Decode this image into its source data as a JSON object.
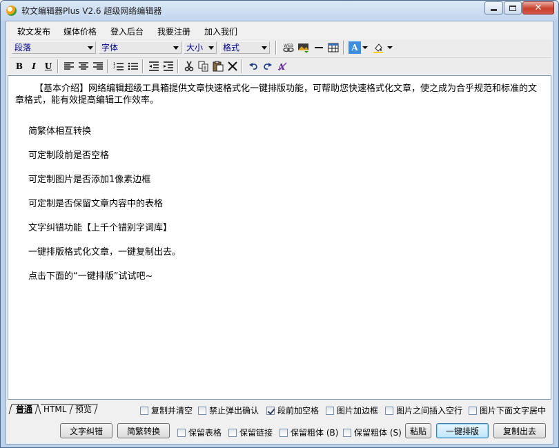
{
  "window": {
    "title": "软文编辑器Plus V2.6 超级网络编辑器",
    "close_glyph": "✕"
  },
  "menu": {
    "items": [
      "软文发布",
      "媒体价格",
      "登入后台",
      "我要注册",
      "加入我们"
    ]
  },
  "toolbar": {
    "paragraph_combo": "段落",
    "font_combo": "字体",
    "size_combo": "大小",
    "format_combo": "格式",
    "icons": {
      "bold": "B",
      "italic": "I",
      "underline": "U",
      "font_color": "A"
    }
  },
  "editor": {
    "intro": "【基本介绍】网络编辑超级工具箱提供文章快速格式化一键排版功能，可帮助您快速格式化文章，使之成为合乎规范和标准的文章格式，能有效提高编辑工作效率。",
    "features": [
      "简繁体相互转换",
      "可定制段前是否空格",
      "可定制图片是否添加1像素边框",
      "可定制是否保留文章内容中的表格",
      "文字纠错功能【上千个错别字词库】",
      "一键排版格式化文章，一键复制出去。",
      "点击下面的“一键排版”试试吧~"
    ]
  },
  "mode_tabs": [
    "普通",
    "HTML",
    "预览"
  ],
  "options_row1": [
    {
      "label": "复制并清空",
      "checked": false
    },
    {
      "label": "禁止弹出确认",
      "checked": false
    },
    {
      "label": "段前加空格",
      "checked": true
    },
    {
      "label": "图片加边框",
      "checked": false
    },
    {
      "label": "图片之间插入空行",
      "checked": false
    },
    {
      "label": "图片下面文字居中",
      "checked": false
    }
  ],
  "actions": {
    "spell_check": "文字纠错",
    "convert": "简繁转换",
    "keep_table": "保留表格",
    "keep_links": "保留链接",
    "keep_bold_b": "保留粗体 (B)",
    "keep_bold_s": "保留粗体 (S)",
    "paste": "粘贴",
    "one_click": "一键排版",
    "copy_out": "复制出去"
  },
  "colors": {
    "titlebar": "#c3d6ee",
    "close_button": "#c8402f",
    "combo_text": "#00008b"
  }
}
